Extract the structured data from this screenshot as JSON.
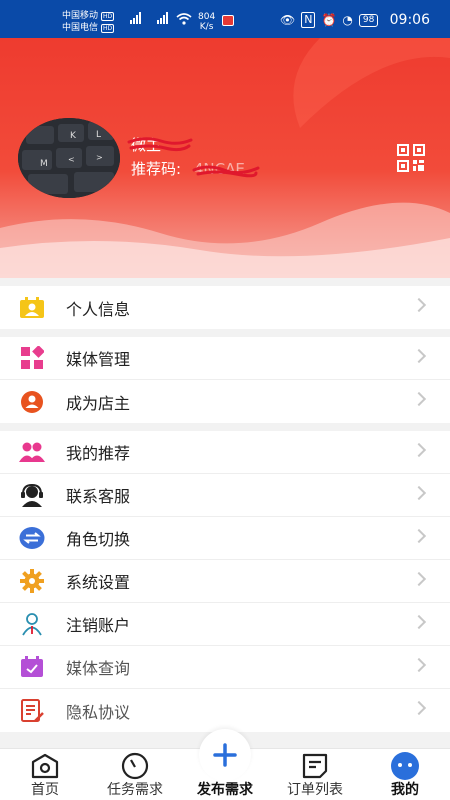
{
  "status_bar": {
    "carrier1": "中国移动",
    "carrier2": "中国电信",
    "hd": "HD",
    "net_speed_value": "804",
    "net_speed_unit": "K/s",
    "battery": "98",
    "time": "09:06"
  },
  "profile": {
    "username_label": "微主",
    "ref_code_label": "推荐码:",
    "ref_code_value": "4NCAE"
  },
  "menu": {
    "groups": [
      [
        {
          "label": "个人信息",
          "icon": "id-card-icon",
          "color": "#f5c518"
        }
      ],
      [
        {
          "label": "媒体管理",
          "icon": "grid-icon",
          "color": "#e83d8e"
        },
        {
          "label": "成为店主",
          "icon": "person-circle-icon",
          "color": "#e8531f"
        }
      ],
      [
        {
          "label": "我的推荐",
          "icon": "group-icon",
          "color": "#e8388e"
        },
        {
          "label": "联系客服",
          "icon": "headset-icon",
          "color": "#222222"
        },
        {
          "label": "角色切换",
          "icon": "swap-icon",
          "color": "#3b6fd8"
        },
        {
          "label": "系统设置",
          "icon": "gear-icon",
          "color": "#f0a020"
        },
        {
          "label": "注销账户",
          "icon": "user-outline-icon",
          "color": "#2a8fb0"
        },
        {
          "label": "媒体查询",
          "icon": "calendar-check-icon",
          "color": "#b44fd6"
        },
        {
          "label": "隐私协议",
          "icon": "document-edit-icon",
          "color": "#d94030"
        }
      ]
    ]
  },
  "tabs": [
    {
      "label": "首页",
      "icon": "home-icon"
    },
    {
      "label": "任务需求",
      "icon": "task-icon"
    },
    {
      "label": "发布需求",
      "icon": "plus-icon"
    },
    {
      "label": "订单列表",
      "icon": "order-list-icon"
    },
    {
      "label": "我的",
      "icon": "profile-face-icon"
    }
  ],
  "colors": {
    "status_bar": "#0a4aa8",
    "header_red": "#ee3b2f",
    "accent_blue": "#2a6fdb"
  }
}
